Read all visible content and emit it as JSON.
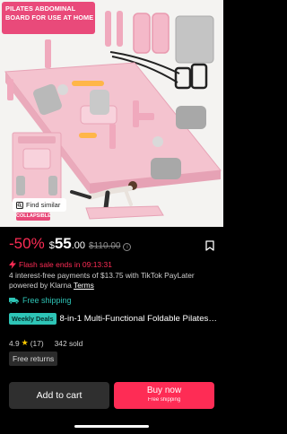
{
  "hero": {
    "banner_line1": "PILATES ABDOMINAL",
    "banner_line2": "BOARD FOR USE AT HOME",
    "find_similar": "Find similar",
    "collapsible_tag": "COLLAPSIBLE"
  },
  "price": {
    "discount": "-50%",
    "currency": "$",
    "whole": "55",
    "cents": ".00",
    "original": "$110.00"
  },
  "flash": {
    "text": "Flash sale ends in 09:13:31"
  },
  "payment": {
    "text": "4 interest-free payments of $13.75 with  TikTok PayLater powered by Klarna",
    "terms_link": "Terms"
  },
  "shipping": {
    "text": "Free shipping"
  },
  "product": {
    "deal_badge": "Weekly Deals",
    "title": "8-in-1 Multi-Functional Foldable Pilates Board, 24 Non-Slip Feet, Small Space...",
    "rating": "4.9",
    "reviews": "(17)",
    "sold": "342 sold"
  },
  "returns": {
    "label": "Free returns"
  },
  "actions": {
    "add_to_cart": "Add to cart",
    "buy_now": "Buy now",
    "buy_now_sub": "Free shipping"
  },
  "colors": {
    "accent": "#fe2c55",
    "teal": "#2ec4b6",
    "board_pink": "#f2b8c8",
    "banner_pink": "#e94a7a"
  }
}
